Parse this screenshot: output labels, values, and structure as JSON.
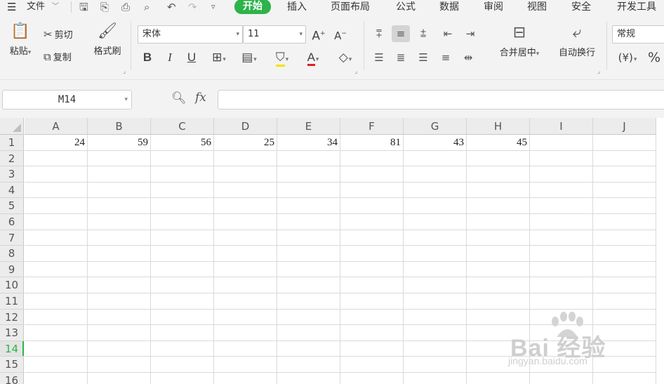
{
  "menubar": {
    "menu_icon": "hamburger-icon",
    "file_label": "文件",
    "tabs": [
      "开始",
      "插入",
      "页面布局",
      "公式",
      "数据",
      "审阅",
      "视图",
      "安全",
      "开发工具"
    ],
    "active_tab": "开始",
    "accent": "#2db34a"
  },
  "ribbon": {
    "paste_label": "粘贴",
    "cut_label": "剪切",
    "copy_label": "复制",
    "format_painter_label": "格式刷",
    "font_name": "宋体",
    "font_size": "11",
    "merge_center_label": "合并居中",
    "wrap_text_label": "自动换行",
    "number_format": "常规",
    "currency_symbol": "¥",
    "percent_symbol": "%"
  },
  "formula_bar": {
    "name_box": "M14",
    "fx_label": "fx",
    "formula": ""
  },
  "sheet": {
    "columns": [
      "A",
      "B",
      "C",
      "D",
      "E",
      "F",
      "G",
      "H",
      "I",
      "J"
    ],
    "rows": [
      "1",
      "2",
      "3",
      "4",
      "5",
      "6",
      "7",
      "8",
      "9",
      "10",
      "11",
      "12",
      "13",
      "14",
      "15",
      "16"
    ],
    "active_row": "14",
    "row1_values": [
      "24",
      "59",
      "56",
      "25",
      "34",
      "81",
      "43",
      "45",
      "",
      ""
    ]
  },
  "watermark": {
    "logo_text": "Bai 经验",
    "url": "jingyan.baidu.com"
  }
}
